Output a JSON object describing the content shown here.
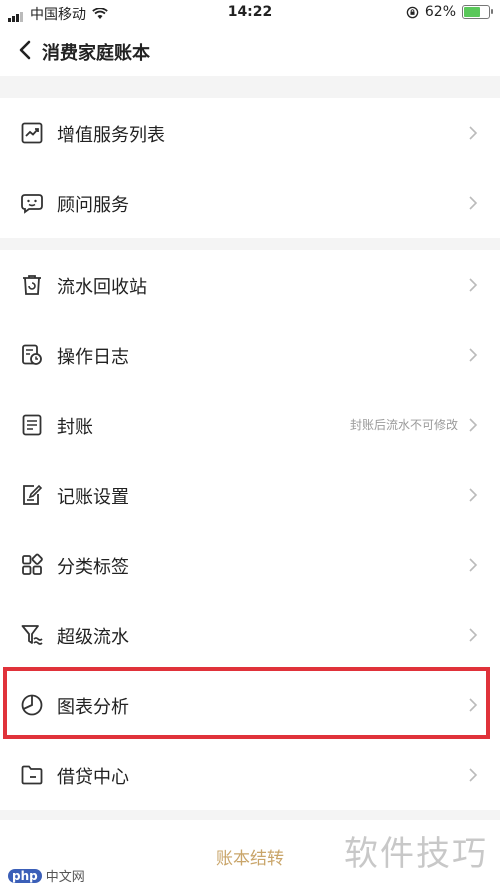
{
  "status_bar": {
    "carrier": "中国移动",
    "time": "14:22",
    "battery": "62%",
    "battery_level": 0.62
  },
  "header": {
    "title": "消费家庭账本"
  },
  "group1": [
    {
      "label": "增值服务列表",
      "icon": "trend-chart-icon"
    },
    {
      "label": "顾问服务",
      "icon": "chat-bubble-icon"
    }
  ],
  "group2": [
    {
      "label": "流水回收站",
      "icon": "trash-icon",
      "hint": ""
    },
    {
      "label": "操作日志",
      "icon": "log-icon",
      "hint": ""
    },
    {
      "label": "封账",
      "icon": "document-icon",
      "hint": "封账后流水不可修改"
    },
    {
      "label": "记账设置",
      "icon": "edit-icon",
      "hint": ""
    },
    {
      "label": "分类标签",
      "icon": "grid-icon",
      "hint": ""
    },
    {
      "label": "超级流水",
      "icon": "filter-icon",
      "hint": ""
    },
    {
      "label": "图表分析",
      "icon": "pie-chart-icon",
      "hint": ""
    },
    {
      "label": "借贷中心",
      "icon": "folder-icon",
      "hint": ""
    }
  ],
  "footer": {
    "button_label": "账本结转"
  },
  "watermark": {
    "text": "软件技巧",
    "site": "中文网",
    "logo": "php"
  },
  "colors": {
    "highlight": "#e0323a",
    "footer_button": "#c9a56a"
  }
}
